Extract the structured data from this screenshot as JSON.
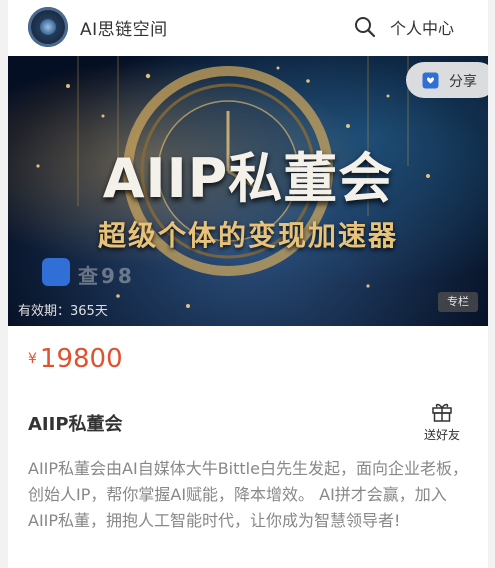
{
  "header": {
    "app_title": "AI思链空间",
    "user_center_label": "个人中心"
  },
  "banner": {
    "title": "AIIP私董会",
    "subtitle": "超级个体的变现加速器",
    "watermark": "查98",
    "share_label": "分享",
    "validity": "有效期：365天",
    "badge": "专栏"
  },
  "product": {
    "currency": "¥",
    "price": "19800",
    "title": "AIIP私董会",
    "gift_label": "送好友",
    "description": "AIIP私董会由AI自媒体大牛Bittle白先生发起，面向企业老板，创始人IP，帮你掌握AI赋能，降本增效。 AI拼才会赢，加入AIIP私董，拥抱人工智能时代，让你成为智慧领导者!"
  },
  "colors": {
    "price": "#e0512f",
    "share_icon": "#2f6fd6"
  },
  "icons": {
    "search": "search-icon",
    "share": "share-icon",
    "gift": "gift-icon"
  }
}
